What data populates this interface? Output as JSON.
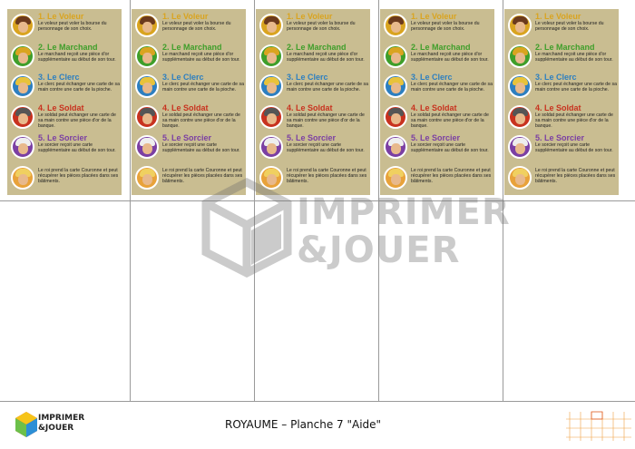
{
  "roles": [
    {
      "name": "1. Le Voleur",
      "color": "#d9a420",
      "desc": "Le voleur peut voler la bourse du personnage de son choix.",
      "avatar_bg": "#d9a420",
      "hair": "#6b3a1d"
    },
    {
      "name": "2. Le Marchand",
      "color": "#3f9e2a",
      "desc": "Le marchand reçoit une pièce d'or supplémentaire au début de son tour.",
      "avatar_bg": "#3f9e2a",
      "hair": "#d9a420"
    },
    {
      "name": "3. Le Clerc",
      "color": "#2d7fc0",
      "desc": "Le clerc peut échanger une carte de sa main contre une carte de la pioche.",
      "avatar_bg": "#2d7fc0",
      "hair": "#e8c23a"
    },
    {
      "name": "4. Le Soldat",
      "color": "#c8321f",
      "desc": "Le soldat peut échanger une carte de sa main contre une pièce d'or de la banque.",
      "avatar_bg": "#c8321f",
      "hair": "#555555"
    },
    {
      "name": "5. Le Sorcier",
      "color": "#7b3fa3",
      "desc": "Le sorcier reçoit une carte supplémentaire au début de son tour.",
      "avatar_bg": "#7b3fa3",
      "hair": "#eeeeee"
    },
    {
      "name": "",
      "color": "#d99a20",
      "desc": "Le roi prend la carte Couronne et peut récupérer les pièces placées dans ses bâtiments.",
      "avatar_bg": "#e8a23a",
      "hair": "#f0d060"
    }
  ],
  "watermark": {
    "line1": "IMPRIMER",
    "line2": "&JOUER"
  },
  "footer": {
    "title": "ROYAUME – Planche 7 \"Aide\"",
    "logo_line1": "IMPRIMER",
    "logo_line2": "&JOUER"
  }
}
